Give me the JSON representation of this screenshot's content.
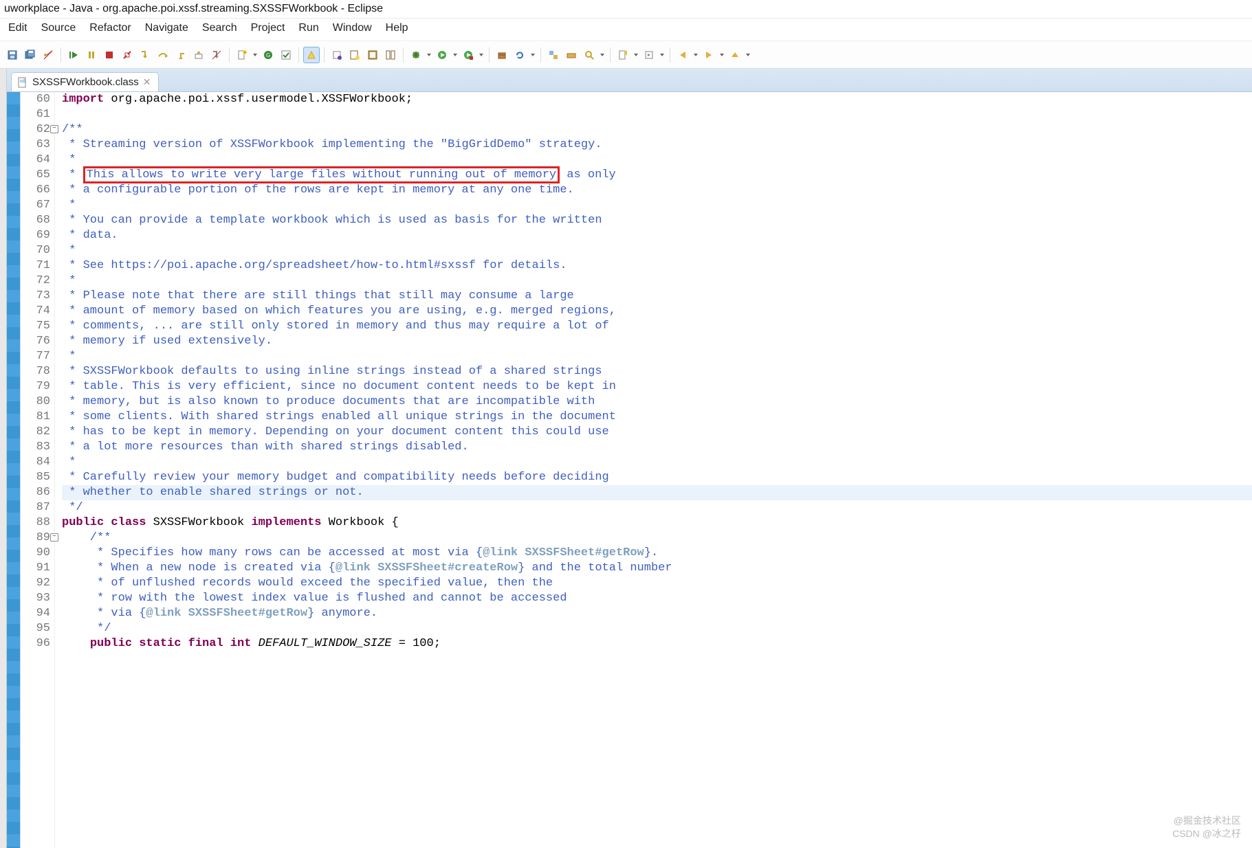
{
  "title": "uworkplace - Java - org.apache.poi.xssf.streaming.SXSSFWorkbook - Eclipse",
  "menus": [
    "Edit",
    "Source",
    "Refactor",
    "Navigate",
    "Search",
    "Project",
    "Run",
    "Window",
    "Help"
  ],
  "tab": {
    "label": "SXSSFWorkbook.class"
  },
  "code": {
    "lines": [
      {
        "n": 60,
        "kind": "code",
        "tokens": [
          {
            "t": "kw",
            "v": "import"
          },
          {
            "t": "txt",
            "v": " org.apache.poi.xssf.usermodel.XSSFWorkbook;"
          }
        ]
      },
      {
        "n": 61,
        "kind": "blank"
      },
      {
        "n": 62,
        "kind": "jd",
        "fold": true,
        "text": "/**"
      },
      {
        "n": 63,
        "kind": "jd",
        "text": " * Streaming version of XSSFWorkbook implementing the \"BigGridDemo\" strategy."
      },
      {
        "n": 64,
        "kind": "jd",
        "text": " *"
      },
      {
        "n": 65,
        "kind": "jd",
        "tokens": [
          {
            "t": "jd",
            "v": " * "
          },
          {
            "t": "jdbox",
            "v": "This allows to write very large files without running out of memory"
          },
          {
            "t": "jd",
            "v": " as only"
          }
        ]
      },
      {
        "n": 66,
        "kind": "jd",
        "text": " * a configurable portion of the rows are kept in memory at any one time."
      },
      {
        "n": 67,
        "kind": "jd",
        "text": " *"
      },
      {
        "n": 68,
        "kind": "jd",
        "text": " * You can provide a template workbook which is used as basis for the written"
      },
      {
        "n": 69,
        "kind": "jd",
        "text": " * data."
      },
      {
        "n": 70,
        "kind": "jd",
        "text": " *"
      },
      {
        "n": 71,
        "kind": "jd",
        "text": " * See https://poi.apache.org/spreadsheet/how-to.html#sxssf for details."
      },
      {
        "n": 72,
        "kind": "jd",
        "text": " *"
      },
      {
        "n": 73,
        "kind": "jd",
        "text": " * Please note that there are still things that still may consume a large"
      },
      {
        "n": 74,
        "kind": "jd",
        "text": " * amount of memory based on which features you are using, e.g. merged regions,"
      },
      {
        "n": 75,
        "kind": "jd",
        "text": " * comments, ... are still only stored in memory and thus may require a lot of"
      },
      {
        "n": 76,
        "kind": "jd",
        "text": " * memory if used extensively."
      },
      {
        "n": 77,
        "kind": "jd",
        "text": " *"
      },
      {
        "n": 78,
        "kind": "jd",
        "text": " * SXSSFWorkbook defaults to using inline strings instead of a shared strings"
      },
      {
        "n": 79,
        "kind": "jd",
        "text": " * table. This is very efficient, since no document content needs to be kept in"
      },
      {
        "n": 80,
        "kind": "jd",
        "text": " * memory, but is also known to produce documents that are incompatible with"
      },
      {
        "n": 81,
        "kind": "jd",
        "text": " * some clients. With shared strings enabled all unique strings in the document"
      },
      {
        "n": 82,
        "kind": "jd",
        "text": " * has to be kept in memory. Depending on your document content this could use"
      },
      {
        "n": 83,
        "kind": "jd",
        "text": " * a lot more resources than with shared strings disabled."
      },
      {
        "n": 84,
        "kind": "jd",
        "text": " *"
      },
      {
        "n": 85,
        "kind": "jd",
        "text": " * Carefully review your memory budget and compatibility needs before deciding"
      },
      {
        "n": 86,
        "kind": "jd",
        "hl": true,
        "text": " * whether to enable shared strings or not."
      },
      {
        "n": 87,
        "kind": "jd",
        "text": " */"
      },
      {
        "n": 88,
        "kind": "code",
        "tokens": [
          {
            "t": "kw",
            "v": "public class"
          },
          {
            "t": "txt",
            "v": " SXSSFWorkbook "
          },
          {
            "t": "kw",
            "v": "implements"
          },
          {
            "t": "txt",
            "v": " Workbook {"
          }
        ]
      },
      {
        "n": 89,
        "kind": "jd",
        "fold": true,
        "indent": "    ",
        "text": "    /**"
      },
      {
        "n": 90,
        "kind": "jd",
        "tokens": [
          {
            "t": "jd",
            "v": "     * Specifies how many rows can be accessed at most via {"
          },
          {
            "t": "jdtag",
            "v": "@link SXSSFSheet#getRow"
          },
          {
            "t": "jd",
            "v": "}."
          }
        ]
      },
      {
        "n": 91,
        "kind": "jd",
        "tokens": [
          {
            "t": "jd",
            "v": "     * When a new node is created via {"
          },
          {
            "t": "jdtag",
            "v": "@link SXSSFSheet#createRow"
          },
          {
            "t": "jd",
            "v": "} and the total number"
          }
        ]
      },
      {
        "n": 92,
        "kind": "jd",
        "text": "     * of unflushed records would exceed the specified value, then the"
      },
      {
        "n": 93,
        "kind": "jd",
        "text": "     * row with the lowest index value is flushed and cannot be accessed"
      },
      {
        "n": 94,
        "kind": "jd",
        "tokens": [
          {
            "t": "jd",
            "v": "     * via {"
          },
          {
            "t": "jdtag",
            "v": "@link SXSSFSheet#getRow"
          },
          {
            "t": "jd",
            "v": "} anymore."
          }
        ]
      },
      {
        "n": 95,
        "kind": "jd",
        "text": "     */"
      },
      {
        "n": 96,
        "kind": "code",
        "tokens": [
          {
            "t": "txt",
            "v": "    "
          },
          {
            "t": "kw",
            "v": "public static final int"
          },
          {
            "t": "txt",
            "v": " "
          },
          {
            "t": "itxt",
            "v": "DEFAULT_WINDOW_SIZE"
          },
          {
            "t": "txt",
            "v": " = 100;"
          }
        ]
      }
    ]
  },
  "watermark": {
    "line1": "@掘金技术社区",
    "line2": "CSDN @冰之杍"
  },
  "toolbar_names": [
    "save-icon",
    "save-all-icon",
    "toggle-breadcrumb-icon",
    "",
    "resume-icon",
    "pause-icon",
    "stop-icon",
    "disconnect-icon",
    "step-into-icon",
    "step-over-icon",
    "step-return-icon",
    "drop-frame-icon",
    "step-filter-icon",
    "",
    "new-icon",
    "new-drop",
    "open-type-icon",
    "open-task-icon",
    "",
    "highlight-icon",
    "",
    "task-list-icon",
    "task-new-icon",
    "task-focus-icon",
    "task-panel-icon",
    "",
    "debug-icon",
    "debug-drop",
    "run-icon",
    "run-drop",
    "run-ext-icon",
    "run-ext-drop",
    "",
    "package-icon",
    "refresh-icon",
    "refresh-drop",
    "",
    "open-impl-icon",
    "open-hier-icon",
    "search-icon",
    "search-drop",
    "",
    "bookmark-icon",
    "bookmark-drop",
    "nav-icon",
    "nav-drop",
    "",
    "back-icon",
    "back-drop",
    "forward-icon",
    "forward-drop",
    "up-icon",
    "up-drop"
  ]
}
